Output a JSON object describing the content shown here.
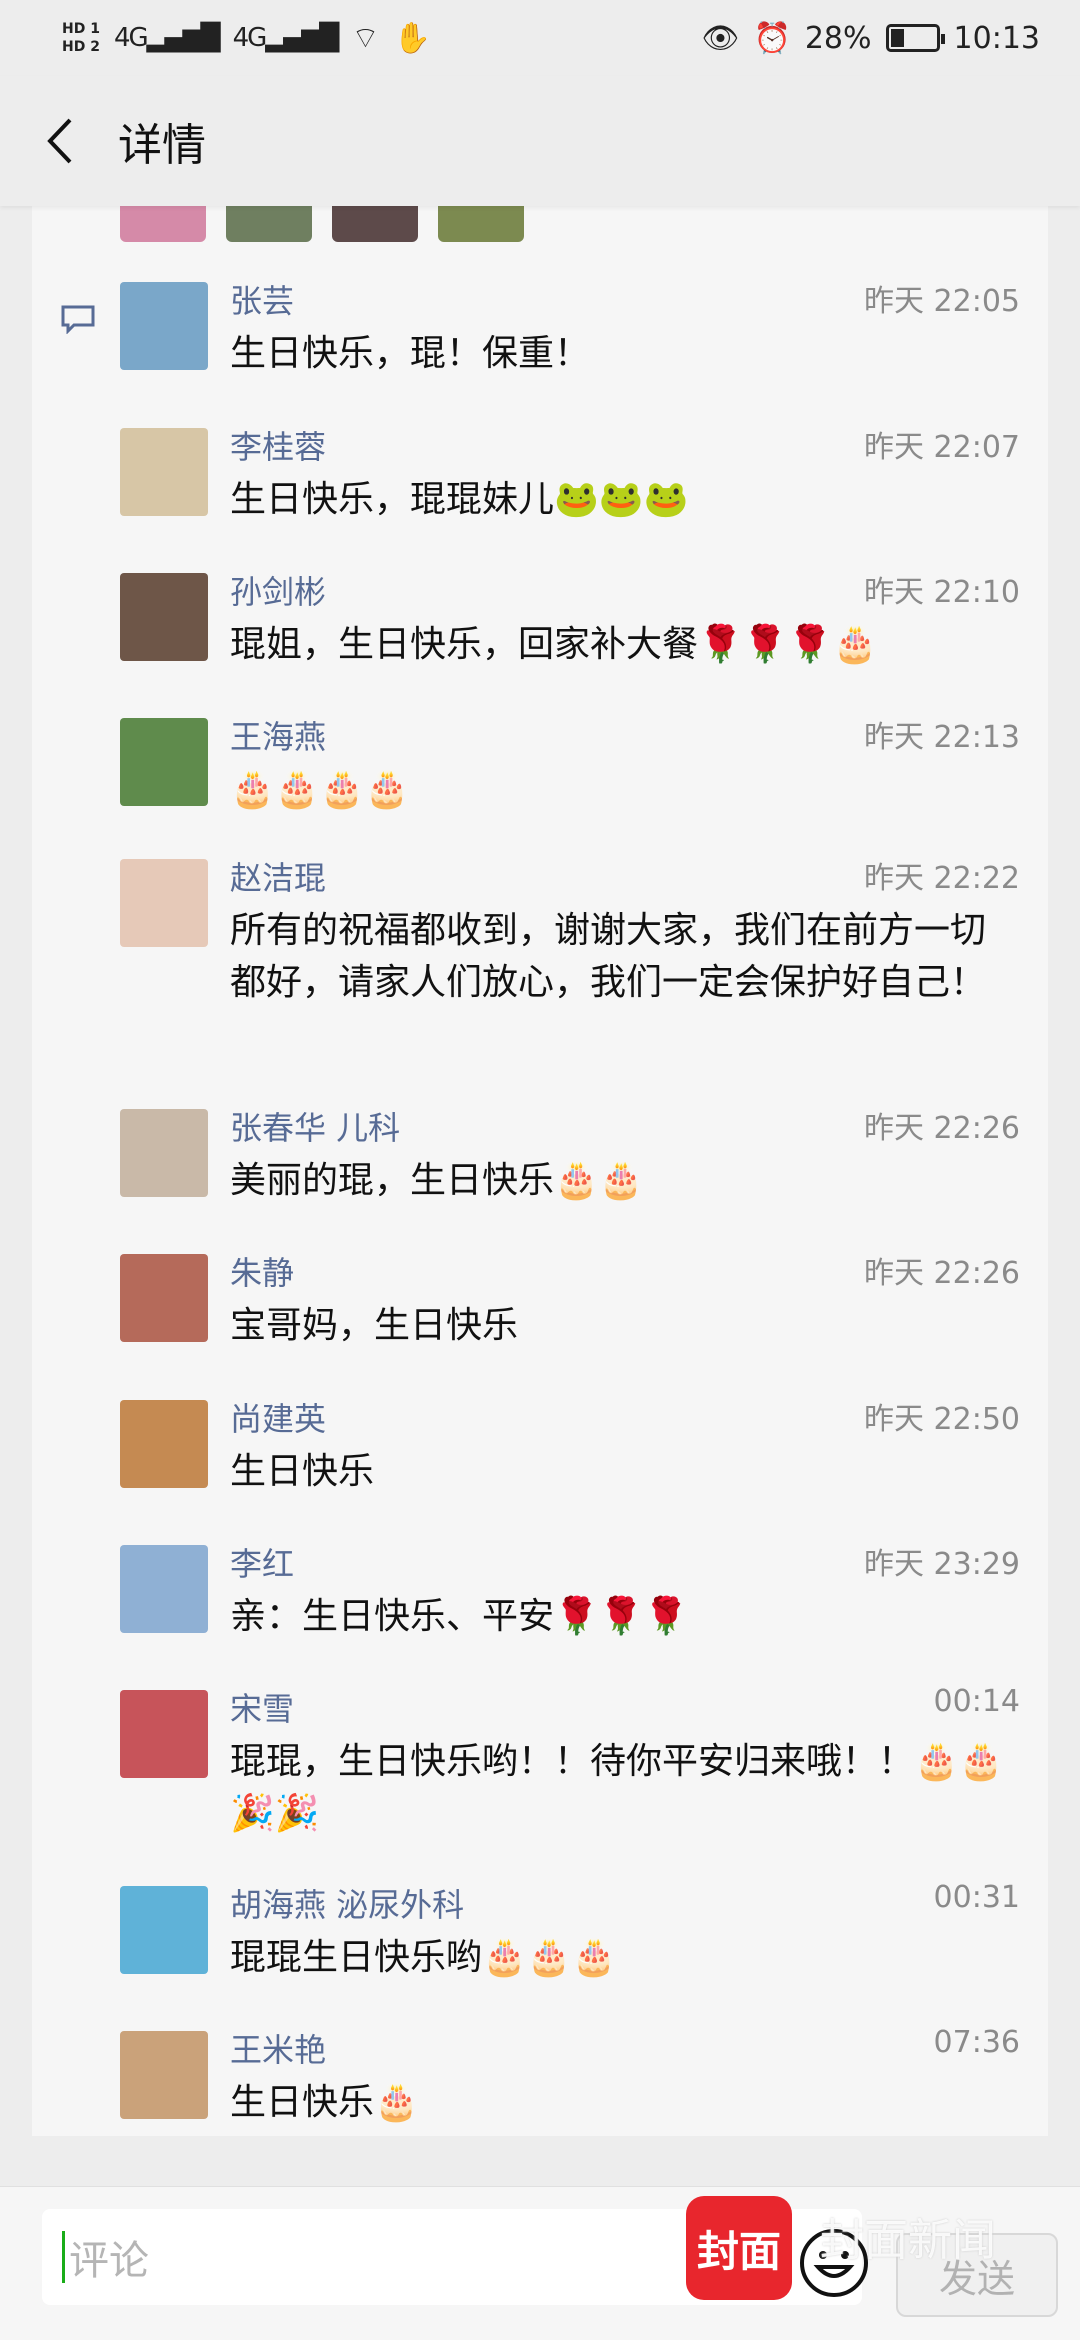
{
  "status": {
    "hd1": "HD 1",
    "hd2": "HD 2",
    "net1": "4G",
    "net2": "4G",
    "battery": "28%",
    "battery_level": 0.28,
    "time": "10:13"
  },
  "header": {
    "title": "详情"
  },
  "comments": [
    {
      "name": "张芸",
      "time": "昨天 22:05",
      "text": "生日快乐，琨！保重！",
      "avatar_color": "#7aa7c9"
    },
    {
      "name": "李桂蓉",
      "time": "昨天 22:07",
      "text": "生日快乐，琨琨妹儿🐸🐸🐸",
      "avatar_color": "#d7c6a6"
    },
    {
      "name": "孙剑彬",
      "time": "昨天 22:10",
      "text": "琨姐，生日快乐，回家补大餐🌹🌹🌹🎂",
      "avatar_color": "#6e5648"
    },
    {
      "name": "王海燕",
      "time": "昨天 22:13",
      "text": "🎂🎂🎂🎂",
      "avatar_color": "#5f8b4c"
    },
    {
      "name": "赵洁琨",
      "time": "昨天 22:22",
      "text": "所有的祝福都收到，谢谢大家，我们在前方一切都好，请家人们放心，我们一定会保护好自己！",
      "avatar_color": "#e6c9b8"
    },
    {
      "name": "张春华 儿科",
      "time": "昨天 22:26",
      "text": "美丽的琨，生日快乐🎂🎂",
      "avatar_color": "#c9b9a8"
    },
    {
      "name": "朱静",
      "time": "昨天 22:26",
      "text": "宝哥妈，生日快乐",
      "avatar_color": "#b56a5a"
    },
    {
      "name": "尚建英",
      "time": "昨天 22:50",
      "text": "生日快乐",
      "avatar_color": "#c58a52"
    },
    {
      "name": "李红",
      "time": "昨天 23:29",
      "text": "亲：生日快乐、平安🌹🌹🌹",
      "avatar_color": "#8fb0d4"
    },
    {
      "name": "宋雪",
      "time": "00:14",
      "text": "琨琨，生日快乐哟！！待你平安归来哦！！🎂🎂🎉🎉",
      "avatar_color": "#c7545a"
    },
    {
      "name": "胡海燕 泌尿外科",
      "time": "00:31",
      "text": "琨琨生日快乐哟🎂🎂🎂",
      "avatar_color": "#5fb2d8"
    },
    {
      "name": "王米艳",
      "time": "07:36",
      "text": "生日快乐🎂",
      "avatar_color": "#caa27a"
    }
  ],
  "input": {
    "placeholder": "评论"
  },
  "send_label": "发送",
  "watermark": {
    "logo": "封面",
    "text": "封面新闻"
  }
}
